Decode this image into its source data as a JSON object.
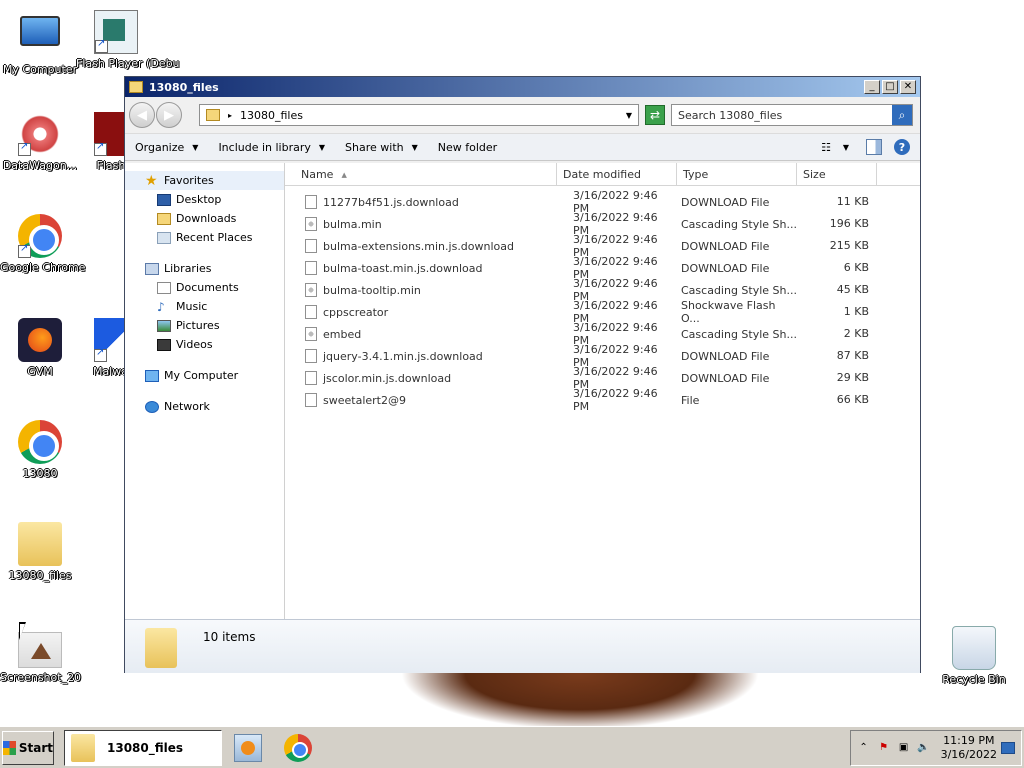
{
  "desktop": {
    "icons": [
      {
        "label": "My Computer"
      },
      {
        "label": "Flash Player (Debu"
      },
      {
        "label": "DataWagon..."
      },
      {
        "label": "Flash P"
      },
      {
        "label": "Google Chrome"
      },
      {
        "label": "GVM"
      },
      {
        "label": "Malware"
      },
      {
        "label": "13080"
      },
      {
        "label": "13080_files"
      },
      {
        "label": "Screenshot_20"
      },
      {
        "label": "Recycle Bin"
      }
    ]
  },
  "window": {
    "title": "13080_files",
    "controls": {
      "minimize": "_",
      "maximize": "□",
      "close": "✕"
    },
    "address": {
      "path": "13080_files",
      "separator": "▸"
    },
    "search": {
      "placeholder": "Search 13080_files"
    },
    "commands": {
      "organize": "Organize",
      "include": "Include in library",
      "share": "Share with",
      "new_folder": "New folder"
    },
    "nav": {
      "favorites": {
        "label": "Favorites",
        "items": [
          "Desktop",
          "Downloads",
          "Recent Places"
        ]
      },
      "libraries": {
        "label": "Libraries",
        "items": [
          "Documents",
          "Music",
          "Pictures",
          "Videos"
        ]
      },
      "computer": {
        "label": "My Computer"
      },
      "network": {
        "label": "Network"
      }
    },
    "columns": {
      "name": "Name",
      "date": "Date modified",
      "type": "Type",
      "size": "Size"
    },
    "files": [
      {
        "name": "11277b4f51.js.download",
        "date": "3/16/2022 9:46 PM",
        "type": "DOWNLOAD File",
        "size": "11 KB",
        "icon": "file-icon"
      },
      {
        "name": "bulma.min",
        "date": "3/16/2022 9:46 PM",
        "type": "Cascading Style Sh...",
        "size": "196 KB",
        "icon": "css-file-icon"
      },
      {
        "name": "bulma-extensions.min.js.download",
        "date": "3/16/2022 9:46 PM",
        "type": "DOWNLOAD File",
        "size": "215 KB",
        "icon": "file-icon"
      },
      {
        "name": "bulma-toast.min.js.download",
        "date": "3/16/2022 9:46 PM",
        "type": "DOWNLOAD File",
        "size": "6 KB",
        "icon": "file-icon"
      },
      {
        "name": "bulma-tooltip.min",
        "date": "3/16/2022 9:46 PM",
        "type": "Cascading Style Sh...",
        "size": "45 KB",
        "icon": "css-file-icon"
      },
      {
        "name": "cppscreator",
        "date": "3/16/2022 9:46 PM",
        "type": "Shockwave Flash O...",
        "size": "1 KB",
        "icon": "file-icon"
      },
      {
        "name": "embed",
        "date": "3/16/2022 9:46 PM",
        "type": "Cascading Style Sh...",
        "size": "2 KB",
        "icon": "css-file-icon"
      },
      {
        "name": "jquery-3.4.1.min.js.download",
        "date": "3/16/2022 9:46 PM",
        "type": "DOWNLOAD File",
        "size": "87 KB",
        "icon": "file-icon"
      },
      {
        "name": "jscolor.min.js.download",
        "date": "3/16/2022 9:46 PM",
        "type": "DOWNLOAD File",
        "size": "29 KB",
        "icon": "file-icon"
      },
      {
        "name": "sweetalert2@9",
        "date": "3/16/2022 9:46 PM",
        "type": "File",
        "size": "66 KB",
        "icon": "file-icon"
      }
    ],
    "status": {
      "items_count": "10 items"
    }
  },
  "taskbar": {
    "start": "Start",
    "task_label": "13080_files",
    "clock": {
      "time": "11:19 PM",
      "date": "3/16/2022"
    }
  },
  "colors": {
    "titlebar_start": "#0a246a",
    "titlebar_end": "#a6caf0",
    "taskbar": "#d4d0c8"
  }
}
